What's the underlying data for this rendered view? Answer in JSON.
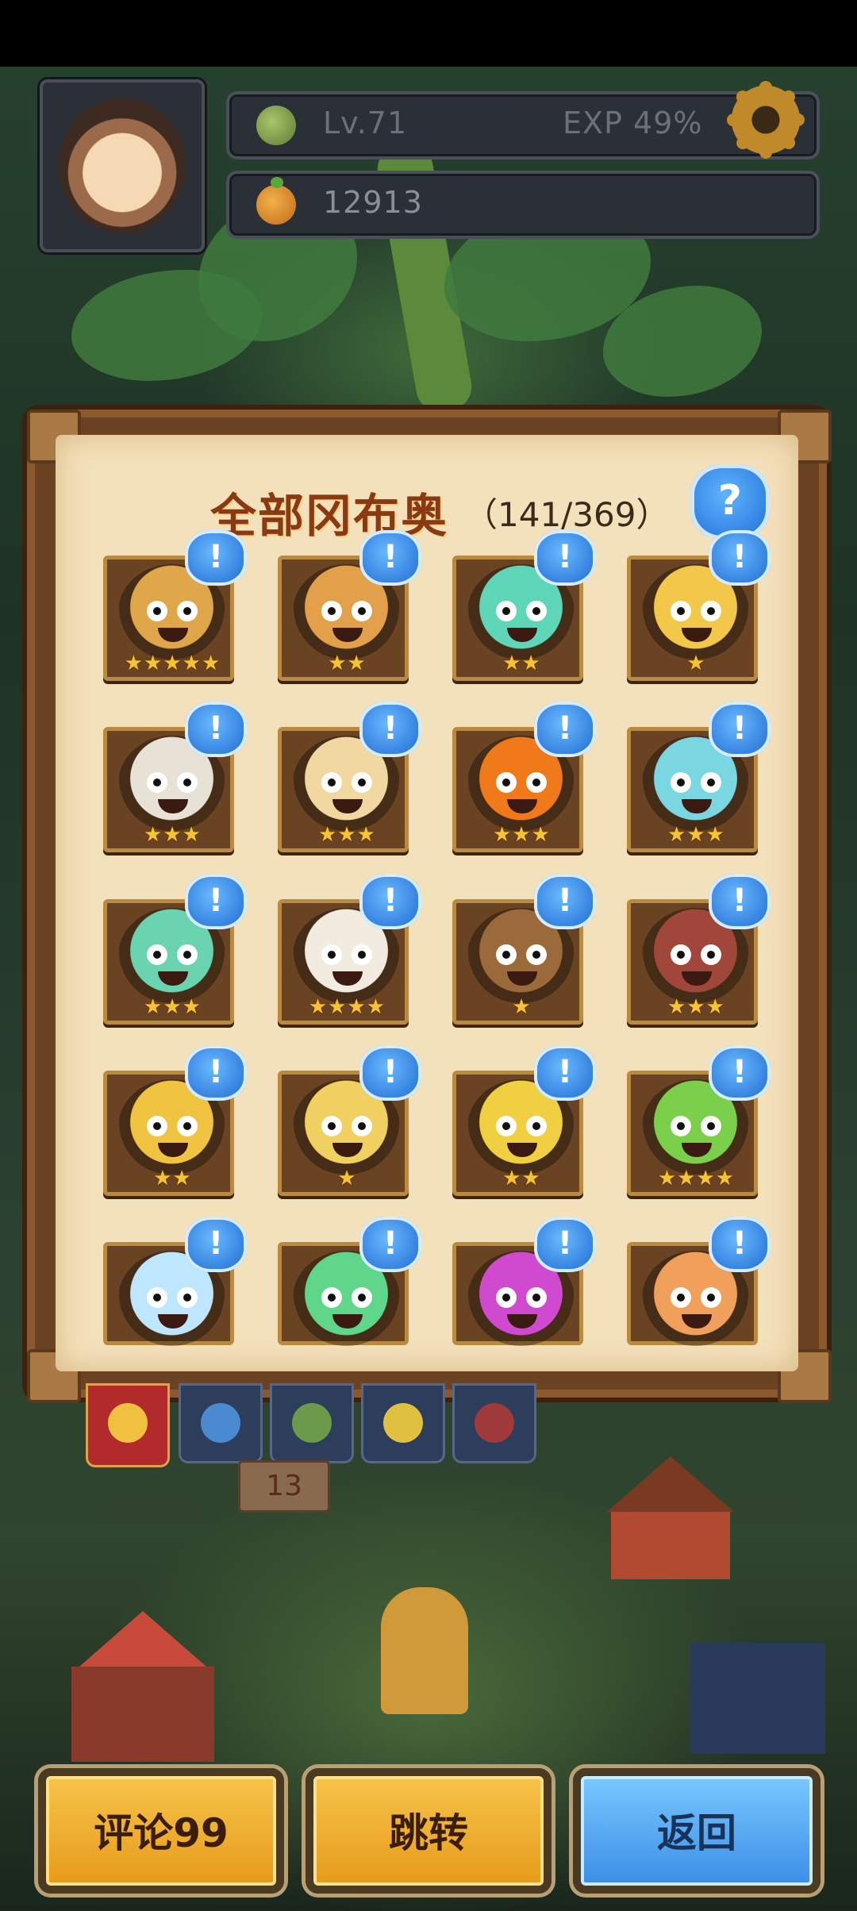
{
  "hud": {
    "level": "Lv.71",
    "exp": "EXP 49%",
    "coins": "12913"
  },
  "collection": {
    "title": "全部冈布奥",
    "count": "（141/369）",
    "help_label": "?"
  },
  "cards": [
    {
      "stars": "★★★★★",
      "color": "#e0a64a"
    },
    {
      "stars": "★★",
      "color": "#e2a04a"
    },
    {
      "stars": "★★",
      "color": "#5fd6b8"
    },
    {
      "stars": "★",
      "color": "#f3c84a"
    },
    {
      "stars": "★★★",
      "color": "#e8e2d6"
    },
    {
      "stars": "★★★",
      "color": "#f0d8a0"
    },
    {
      "stars": "★★★",
      "color": "#f07a1a"
    },
    {
      "stars": "★★★",
      "color": "#7ad6e0"
    },
    {
      "stars": "★★★",
      "color": "#6ad4b0"
    },
    {
      "stars": "★★★★",
      "color": "#f2ece0"
    },
    {
      "stars": "★",
      "color": "#9a6a3a"
    },
    {
      "stars": "★★★",
      "color": "#a0463a"
    },
    {
      "stars": "★★",
      "color": "#f0c440"
    },
    {
      "stars": "★",
      "color": "#f0d060"
    },
    {
      "stars": "★★",
      "color": "#f0d040"
    },
    {
      "stars": "★★★★",
      "color": "#7ad04a"
    },
    {
      "stars": "",
      "color": "#bfe6ff"
    },
    {
      "stars": "",
      "color": "#5fd68a"
    },
    {
      "stars": "",
      "color": "#d04ad0"
    },
    {
      "stars": "",
      "color": "#f0a05a"
    }
  ],
  "badge_label": "!",
  "sign_number": "13",
  "buttons": {
    "comment": "评论99",
    "jump": "跳转",
    "back": "返回"
  }
}
